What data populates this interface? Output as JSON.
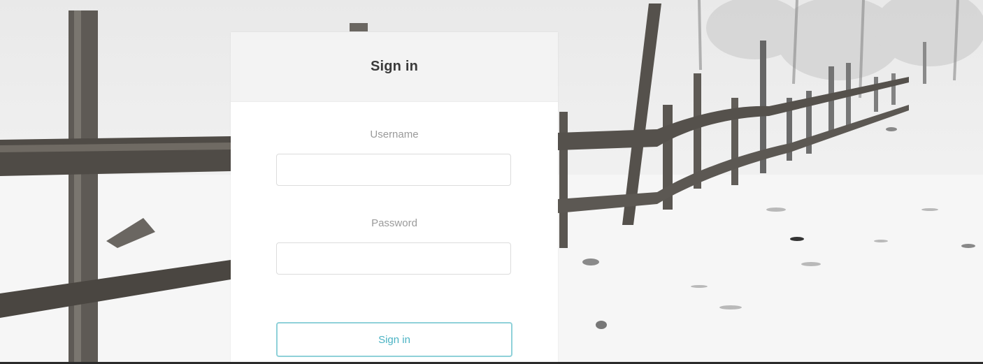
{
  "login": {
    "title": "Sign in",
    "username_label": "Username",
    "username_value": "",
    "password_label": "Password",
    "password_value": "",
    "submit_label": "Sign in"
  },
  "colors": {
    "button_border": "#8fd1d9",
    "button_text": "#4bb3c4",
    "header_bg": "#f3f3f3",
    "label_text": "#9a9a9a"
  }
}
